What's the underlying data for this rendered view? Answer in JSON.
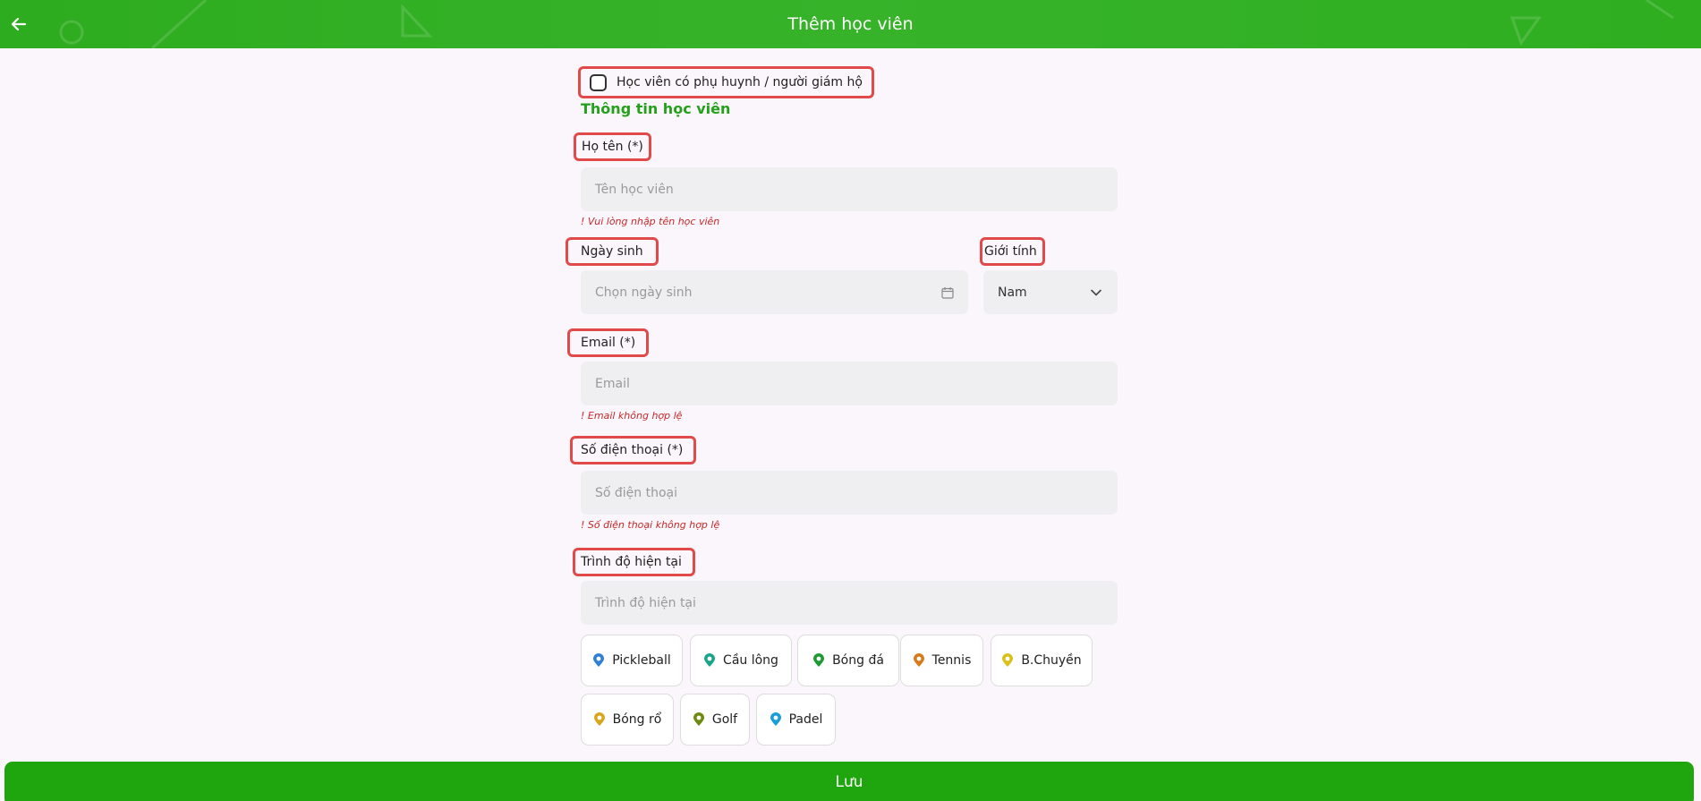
{
  "header": {
    "title": "Thêm học viên",
    "back_icon": "arrow-left-icon"
  },
  "guardian_checkbox": {
    "label": "Học viên có phụ huynh / người giám hộ",
    "checked": false
  },
  "section_title": "Thông tin học viên",
  "fields": {
    "name": {
      "label": "Họ tên (*)",
      "placeholder": "Tên học viên",
      "error": "! Vui lòng nhập tên học viên"
    },
    "birthday": {
      "label": "Ngày sinh",
      "placeholder": "Chọn ngày sinh",
      "icon": "calendar-icon"
    },
    "gender": {
      "label": "Giới tính",
      "value": "Nam",
      "icon": "chevron-down-icon"
    },
    "email": {
      "label": "Email (*)",
      "placeholder": "Email",
      "error": "! Email không hợp lệ"
    },
    "phone": {
      "label": "Số điện thoại (*)",
      "placeholder": "Số điện thoại",
      "error": "! Số điện thoại không hợp lệ"
    },
    "level": {
      "label": "Trình độ hiện tại",
      "placeholder": "Trình độ hiện tại"
    }
  },
  "sports": [
    {
      "label": "Pickleball",
      "icon": "pickleball-icon",
      "color": "#2f7fd8"
    },
    {
      "label": "Cầu lông",
      "icon": "badminton-icon",
      "color": "#1aa58a"
    },
    {
      "label": "Bóng đá",
      "icon": "football-icon",
      "color": "#1e9a32"
    },
    {
      "label": "Tennis",
      "icon": "tennis-icon",
      "color": "#d9791a"
    },
    {
      "label": "B.Chuyền",
      "icon": "volleyball-icon",
      "color": "#d8c21a"
    },
    {
      "label": "Bóng rổ",
      "icon": "basketball-icon",
      "color": "#d9a51a"
    },
    {
      "label": "Golf",
      "icon": "golf-icon",
      "color": "#6f8a10"
    },
    {
      "label": "Padel",
      "icon": "padel-icon",
      "color": "#1a9ed9"
    }
  ],
  "save_button": {
    "label": "Lưu"
  },
  "colors": {
    "primary": "#1fa50e",
    "error": "#c62828",
    "highlight": "#e04a4a"
  }
}
